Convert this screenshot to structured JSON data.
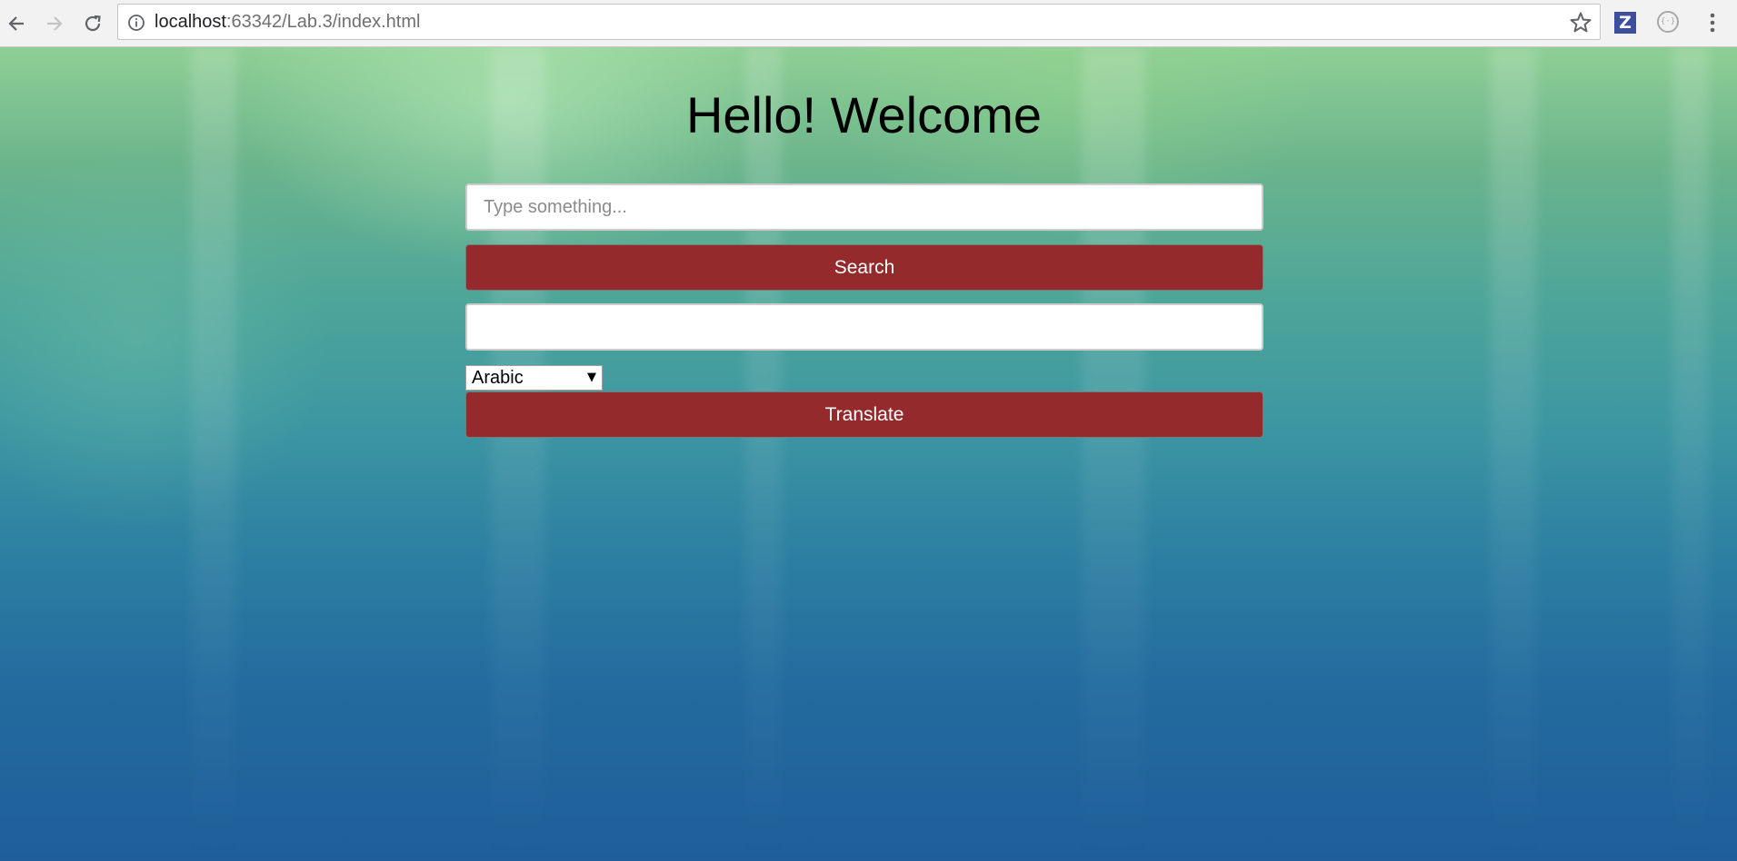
{
  "browser": {
    "url_host": "localhost",
    "url_rest": ":63342/Lab.3/index.html",
    "icons": {
      "back": "back-arrow-icon",
      "forward": "forward-arrow-icon",
      "reload": "reload-icon",
      "info": "info-icon",
      "bookmark": "star-icon",
      "extension_z": "Z",
      "menu": "kebab-menu-icon"
    }
  },
  "page": {
    "title": "Hello! Welcome",
    "search_input": {
      "placeholder": "Type something...",
      "value": ""
    },
    "search_button_label": "Search",
    "result_field_value": "",
    "language_select": {
      "selected": "Arabic",
      "arrow": "▼"
    },
    "translate_button_label": "Translate"
  },
  "colors": {
    "button_bg": "#952a2c",
    "button_text": "#ffffff",
    "background_top": "#8fcf95",
    "background_bottom": "#1f5e9a"
  }
}
